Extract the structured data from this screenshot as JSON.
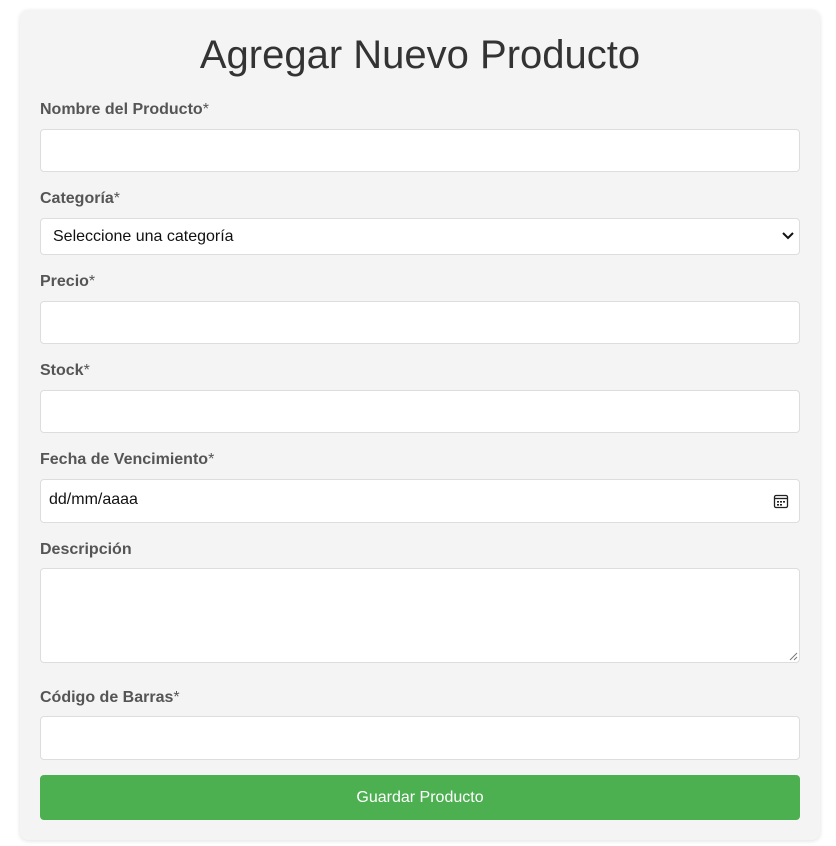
{
  "form": {
    "title": "Agregar Nuevo Producto",
    "required_marker": "*",
    "fields": {
      "name": {
        "label": "Nombre del Producto",
        "value": "",
        "placeholder": ""
      },
      "category": {
        "label": "Categoría",
        "selected": "Seleccione una categoría"
      },
      "price": {
        "label": "Precio",
        "value": "",
        "placeholder": ""
      },
      "stock": {
        "label": "Stock",
        "value": "",
        "placeholder": ""
      },
      "expiry": {
        "label": "Fecha de Vencimiento",
        "display": "dd/mm/aaaa"
      },
      "description": {
        "label": "Descripción",
        "value": ""
      },
      "barcode": {
        "label": "Código de Barras",
        "value": "",
        "placeholder": ""
      }
    },
    "submit_label": "Guardar Producto"
  },
  "colors": {
    "page_background": "#ffffff",
    "card_background": "#f4f4f4",
    "button": "#4caf50",
    "label": "#555555",
    "title": "#333333"
  },
  "icons": {
    "select": "chevron-down-icon",
    "date": "calendar-icon",
    "textarea": "resize-grip-icon"
  }
}
